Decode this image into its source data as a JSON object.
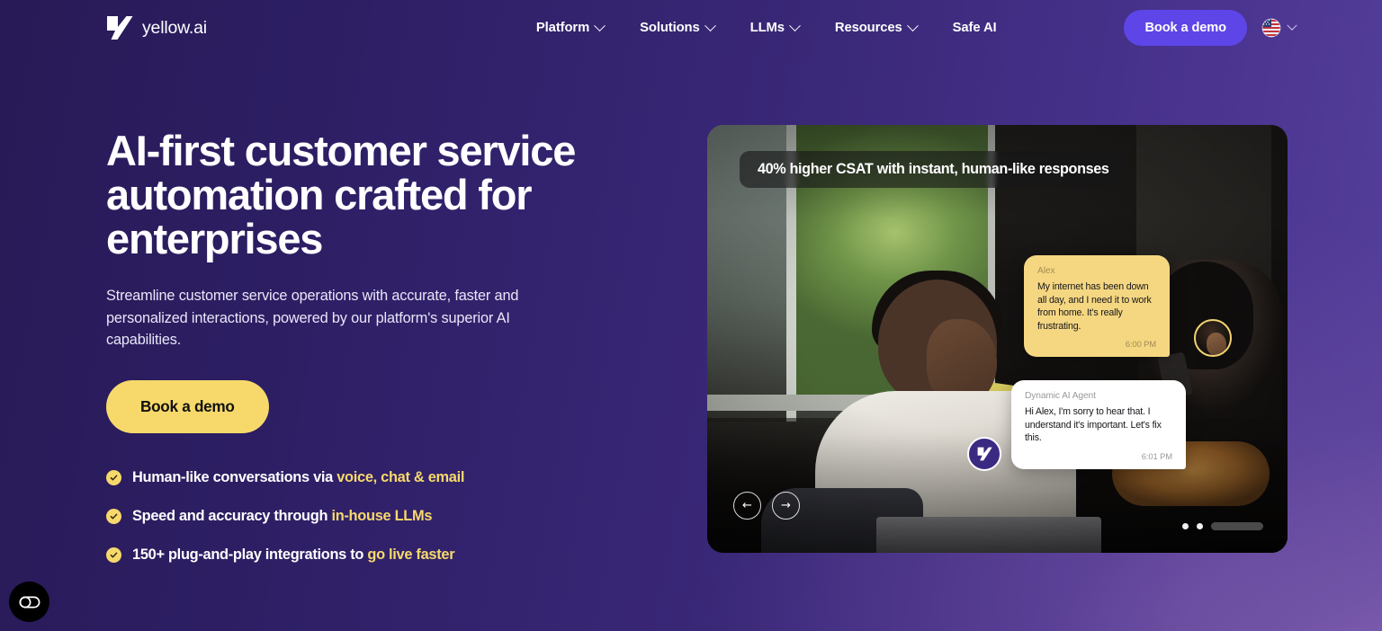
{
  "brand": {
    "name": "yellow.ai",
    "logo_icon": "yellowai-logo-icon"
  },
  "nav": {
    "items": [
      {
        "label": "Platform",
        "has_dropdown": true
      },
      {
        "label": "Solutions",
        "has_dropdown": true
      },
      {
        "label": "LLMs",
        "has_dropdown": true
      },
      {
        "label": "Resources",
        "has_dropdown": true
      },
      {
        "label": "Safe AI",
        "has_dropdown": false
      }
    ],
    "demo_button": "Book a demo",
    "language": {
      "icon": "us-flag-globe-icon",
      "chevron_icon": "chevron-down-icon"
    }
  },
  "hero": {
    "headline": "AI-first customer service automation crafted for enterprises",
    "subhead": "Streamline customer service operations with accurate, faster and personalized interactions, powered by our platform's superior AI capabilities.",
    "cta_label": "Book a demo",
    "features": [
      {
        "plain": "Human-like conversations via ",
        "highlight": "voice, chat & email",
        "icon": "check-circle-icon"
      },
      {
        "plain": "Speed and accuracy through ",
        "highlight": "in-house LLMs",
        "icon": "check-circle-icon"
      },
      {
        "plain": "150+ plug-and-play integrations to ",
        "highlight": "go live faster",
        "icon": "check-circle-icon"
      }
    ]
  },
  "media": {
    "badge": "40% higher CSAT with instant, human-like responses",
    "chat": [
      {
        "sender": "Alex",
        "message": "My internet has been down all day, and I need it to work from home. It's really frustrating.",
        "time": "6:00 PM",
        "role": "user"
      },
      {
        "sender": "Dynamic AI Agent",
        "message": "Hi Alex, I'm sorry to hear that. I understand it's important. Let's fix this.",
        "time": "6:01 PM",
        "role": "agent"
      }
    ],
    "carousel": {
      "prev_icon": "arrow-left-icon",
      "next_icon": "arrow-right-icon",
      "prev_glyph": "←",
      "next_glyph": "→",
      "dots": 2,
      "progress_percent": 70
    },
    "launcher_icon": "yellowai-chat-launcher-icon",
    "avatar_icon": "user-avatar"
  },
  "accessibility_widget": {
    "icon": "accessibility-toggle-icon",
    "label": "Consent preferences"
  },
  "colors": {
    "bg_dark": "#281a56",
    "bg_light": "#55409c",
    "glow": "#9670c4",
    "accent_yellow": "#f7d96b",
    "accent_violet": "#5e45e8",
    "text_white": "#ffffff"
  }
}
